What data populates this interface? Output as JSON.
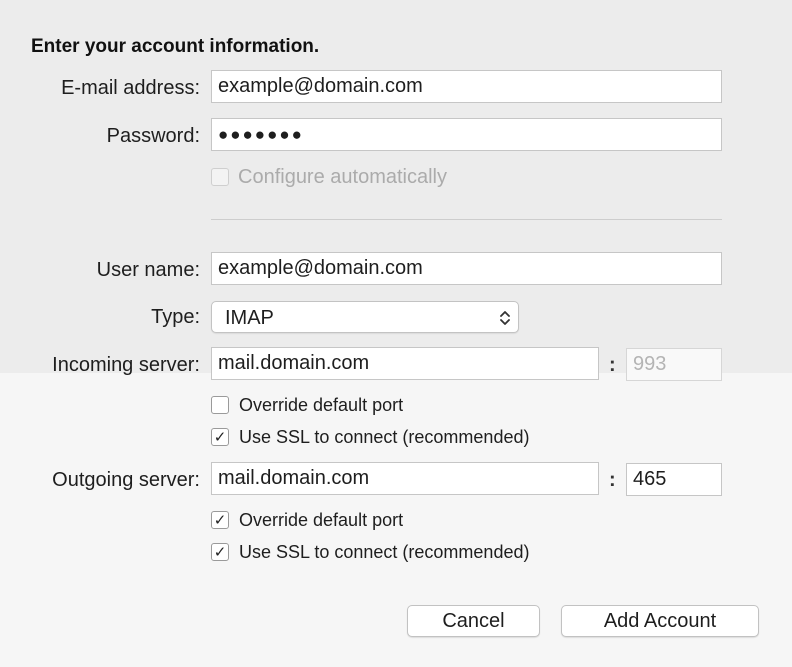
{
  "heading": "Enter your account information.",
  "email": {
    "label": "E-mail address:",
    "value": "example@domain.com"
  },
  "password": {
    "label": "Password:",
    "value": "●●●●●●●"
  },
  "configure_auto": {
    "label": "Configure automatically",
    "checked": false,
    "disabled": true
  },
  "username": {
    "label": "User name:",
    "value": "example@domain.com"
  },
  "type": {
    "label": "Type:",
    "value": "IMAP"
  },
  "incoming": {
    "label": "Incoming server:",
    "server": "mail.domain.com",
    "colon": ":",
    "port": "993",
    "override_label": "Override default port",
    "override_checked": false,
    "ssl_label": "Use SSL to connect (recommended)",
    "ssl_checked": true
  },
  "outgoing": {
    "label": "Outgoing server:",
    "server": "mail.domain.com",
    "colon": ":",
    "port": "465",
    "override_label": "Override default port",
    "override_checked": true,
    "ssl_label": "Use SSL to connect (recommended)",
    "ssl_checked": true
  },
  "buttons": {
    "cancel": "Cancel",
    "add_account": "Add Account"
  },
  "check_mark": "✓"
}
